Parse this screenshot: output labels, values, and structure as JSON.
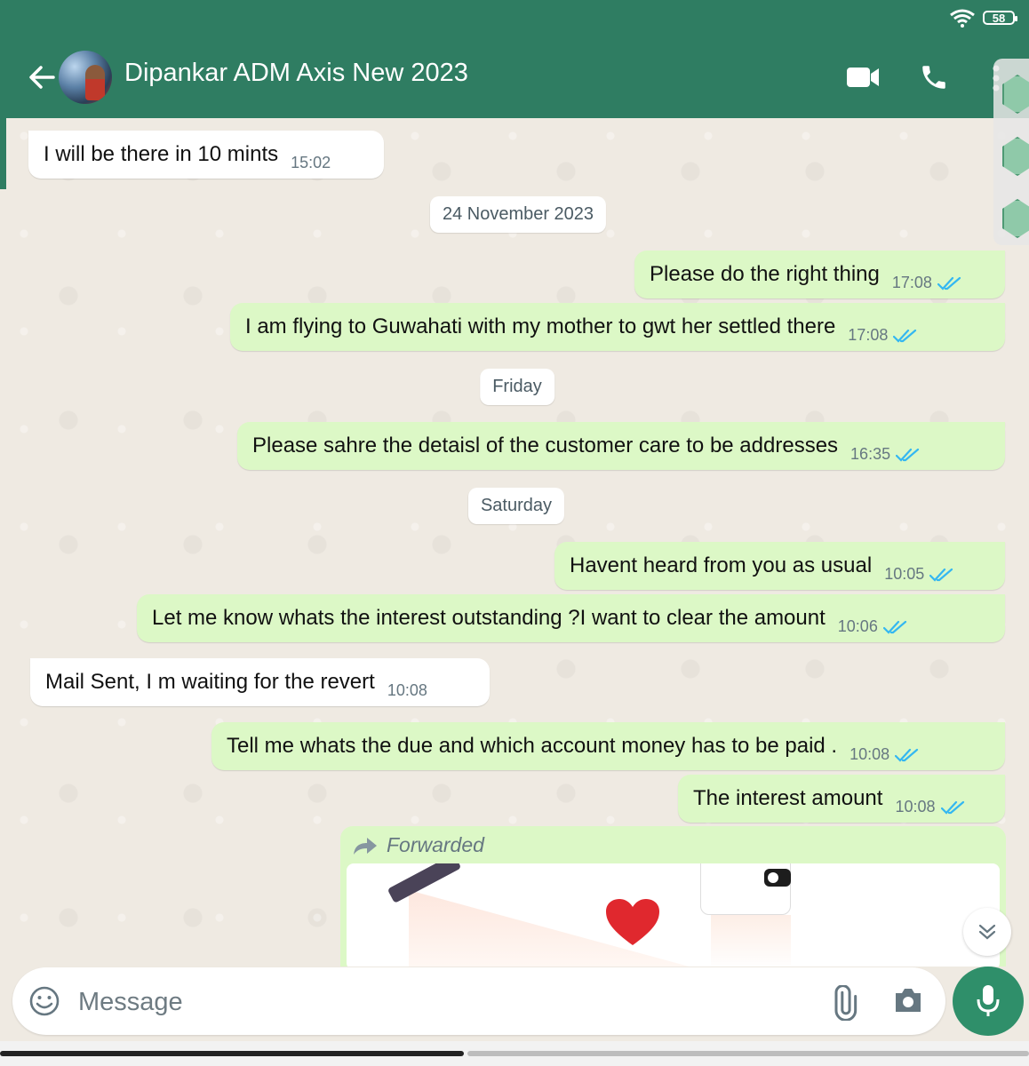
{
  "status_bar": {
    "battery": "58"
  },
  "header": {
    "contact_name": "Dipankar ADM Axis New 2023"
  },
  "dates": {
    "d1": "24 November 2023",
    "d2": "Friday",
    "d3": "Saturday"
  },
  "messages": [
    {
      "direction": "in",
      "text": "I will be there in 10 mints",
      "time": "15:02"
    },
    {
      "direction": "out",
      "text": "Please do the right thing",
      "time": "17:08"
    },
    {
      "direction": "out",
      "text": "I am flying to Guwahati with my mother to gwt her settled there",
      "time": "17:08"
    },
    {
      "direction": "out",
      "text": "Please sahre the detaisl of the customer care to be addresses",
      "time": "16:35"
    },
    {
      "direction": "out",
      "text": "Havent heard from you as usual",
      "time": "10:05"
    },
    {
      "direction": "out",
      "text": "Let me know whats the interest outstanding ?I want to clear the amount",
      "time": "10:06"
    },
    {
      "direction": "in",
      "text": "Mail Sent, I m waiting for the revert",
      "time": "10:08"
    },
    {
      "direction": "out",
      "text": "Tell me whats the due and which account money has to be paid .",
      "time": "10:08"
    },
    {
      "direction": "out",
      "text": "The interest amount",
      "time": "10:08"
    }
  ],
  "forwarded": {
    "label": "Forwarded"
  },
  "composer": {
    "placeholder": "Message"
  },
  "colors": {
    "header": "#2f7d62",
    "outgoing_bubble": "#dcf8c6",
    "incoming_bubble": "#ffffff",
    "read_ticks": "#34b7f1",
    "mic_button": "#2f8f6a"
  }
}
